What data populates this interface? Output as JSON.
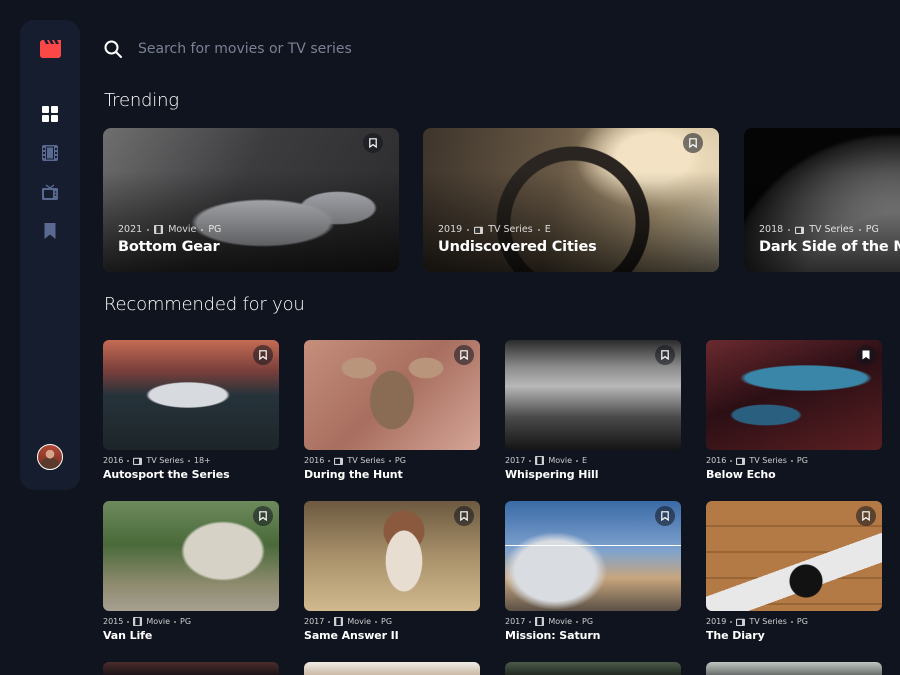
{
  "search": {
    "placeholder": "Search for movies or TV series"
  },
  "sections": {
    "trending": "Trending",
    "recommended": "Recommended for you"
  },
  "nav": {
    "items": [
      {
        "name": "home",
        "icon": "grid-icon",
        "active": true
      },
      {
        "name": "movies",
        "icon": "film-icon",
        "active": false
      },
      {
        "name": "tv-series",
        "icon": "tv-icon",
        "active": false
      },
      {
        "name": "bookmarks",
        "icon": "bookmark-icon",
        "active": false
      }
    ]
  },
  "colors": {
    "background": "#10141E",
    "sidebar": "#161D2F",
    "accent": "#FC4747",
    "nav_inactive": "#5A698F",
    "text": "#FFFFFF"
  },
  "trending": [
    {
      "year": "2021",
      "category": "Movie",
      "rating": "PG",
      "title": "Bottom Gear",
      "bookmarked": false,
      "image": "img-garage"
    },
    {
      "year": "2019",
      "category": "TV Series",
      "rating": "E",
      "title": "Undiscovered Cities",
      "bookmarked": false,
      "image": "img-wheel"
    },
    {
      "year": "2018",
      "category": "TV Series",
      "rating": "PG",
      "title": "Dark Side of the Moon",
      "bookmarked": false,
      "image": "img-moon"
    }
  ],
  "recommended": [
    {
      "year": "2016",
      "category": "TV Series",
      "rating": "18+",
      "title": "Autosport the Series",
      "bookmarked": false,
      "image": "img-car"
    },
    {
      "year": "2016",
      "category": "TV Series",
      "rating": "PG",
      "title": "During the Hunt",
      "bookmarked": false,
      "image": "img-deer"
    },
    {
      "year": "2017",
      "category": "Movie",
      "rating": "E",
      "title": "Whispering Hill",
      "bookmarked": false,
      "image": "img-fog"
    },
    {
      "year": "2016",
      "category": "TV Series",
      "rating": "PG",
      "title": "Below Echo",
      "bookmarked": true,
      "image": "img-cave"
    },
    {
      "year": "2015",
      "category": "Movie",
      "rating": "PG",
      "title": "Van Life",
      "bookmarked": false,
      "image": "img-van"
    },
    {
      "year": "2017",
      "category": "Movie",
      "rating": "PG",
      "title": "Same Answer II",
      "bookmarked": false,
      "image": "img-woman"
    },
    {
      "year": "2017",
      "category": "Movie",
      "rating": "PG",
      "title": "Mission: Saturn",
      "bookmarked": false,
      "image": "img-rocket"
    },
    {
      "year": "2019",
      "category": "TV Series",
      "rating": "PG",
      "title": "The Diary",
      "bookmarked": false,
      "image": "img-desk"
    }
  ]
}
